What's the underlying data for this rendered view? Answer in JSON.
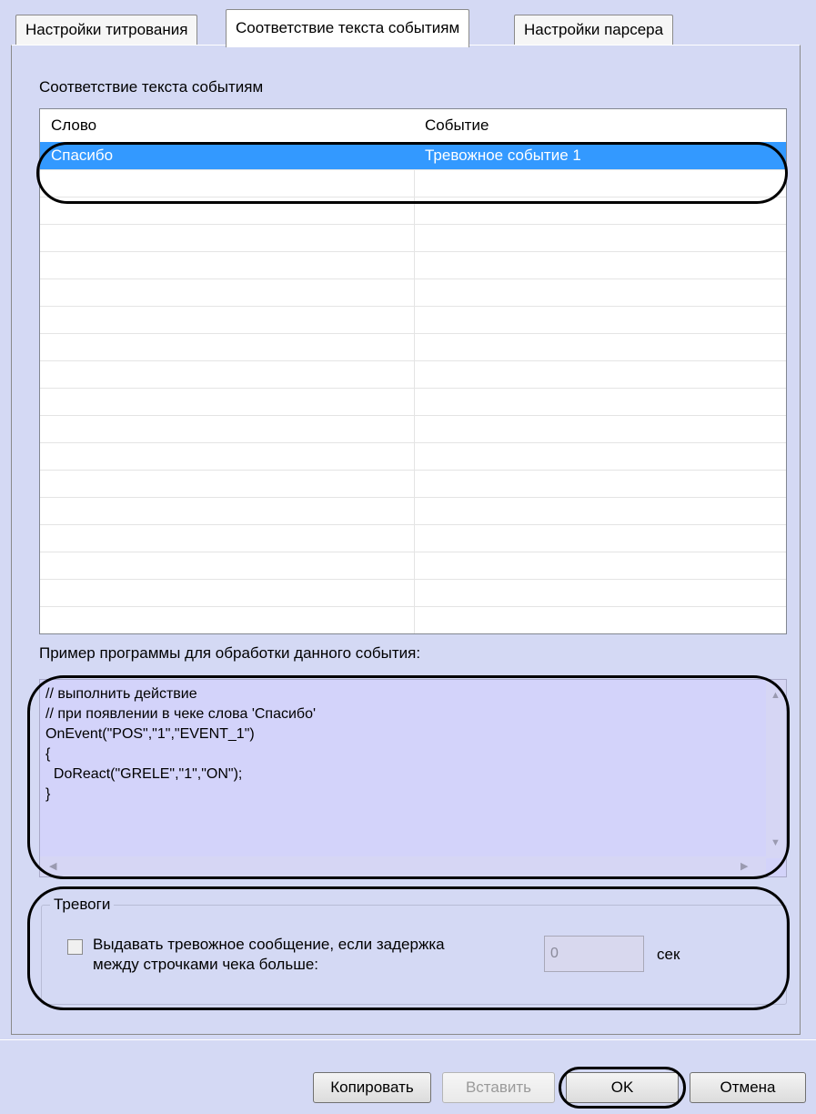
{
  "tabs": [
    {
      "label": "Настройки титрования"
    },
    {
      "label": "Соответствие текста событиям"
    },
    {
      "label": "Настройки парсера"
    }
  ],
  "group_title": "Соответствие текста событиям",
  "table": {
    "columns": [
      "Слово",
      "Событие"
    ],
    "rows": [
      {
        "word": "Спасибо",
        "event": "Тревожное событие 1",
        "selected": true
      }
    ]
  },
  "example": {
    "label": "Пример программы для обработки данного события:",
    "code_lines": [
      "// выполнить действие",
      "// при появлении в чеке слова 'Спасибо'",
      "OnEvent(\"POS\",\"1\",\"EVENT_1\")",
      "{",
      "  DoReact(\"GRELE\",\"1\",\"ON\");",
      "}"
    ]
  },
  "alarms": {
    "title": "Тревоги",
    "checkbox_label_line1": "Выдавать тревожное сообщение, если задержка",
    "checkbox_label_line2": "между строчками чека больше:",
    "checked": false,
    "delay_value": "0",
    "unit": "сек"
  },
  "buttons": {
    "copy": "Копировать",
    "paste": "Вставить",
    "ok": "OK",
    "cancel": "Отмена"
  },
  "colors": {
    "selection": "#3399ff",
    "panel": "#d4d9f4",
    "code_bg": "#d3d3fa"
  }
}
